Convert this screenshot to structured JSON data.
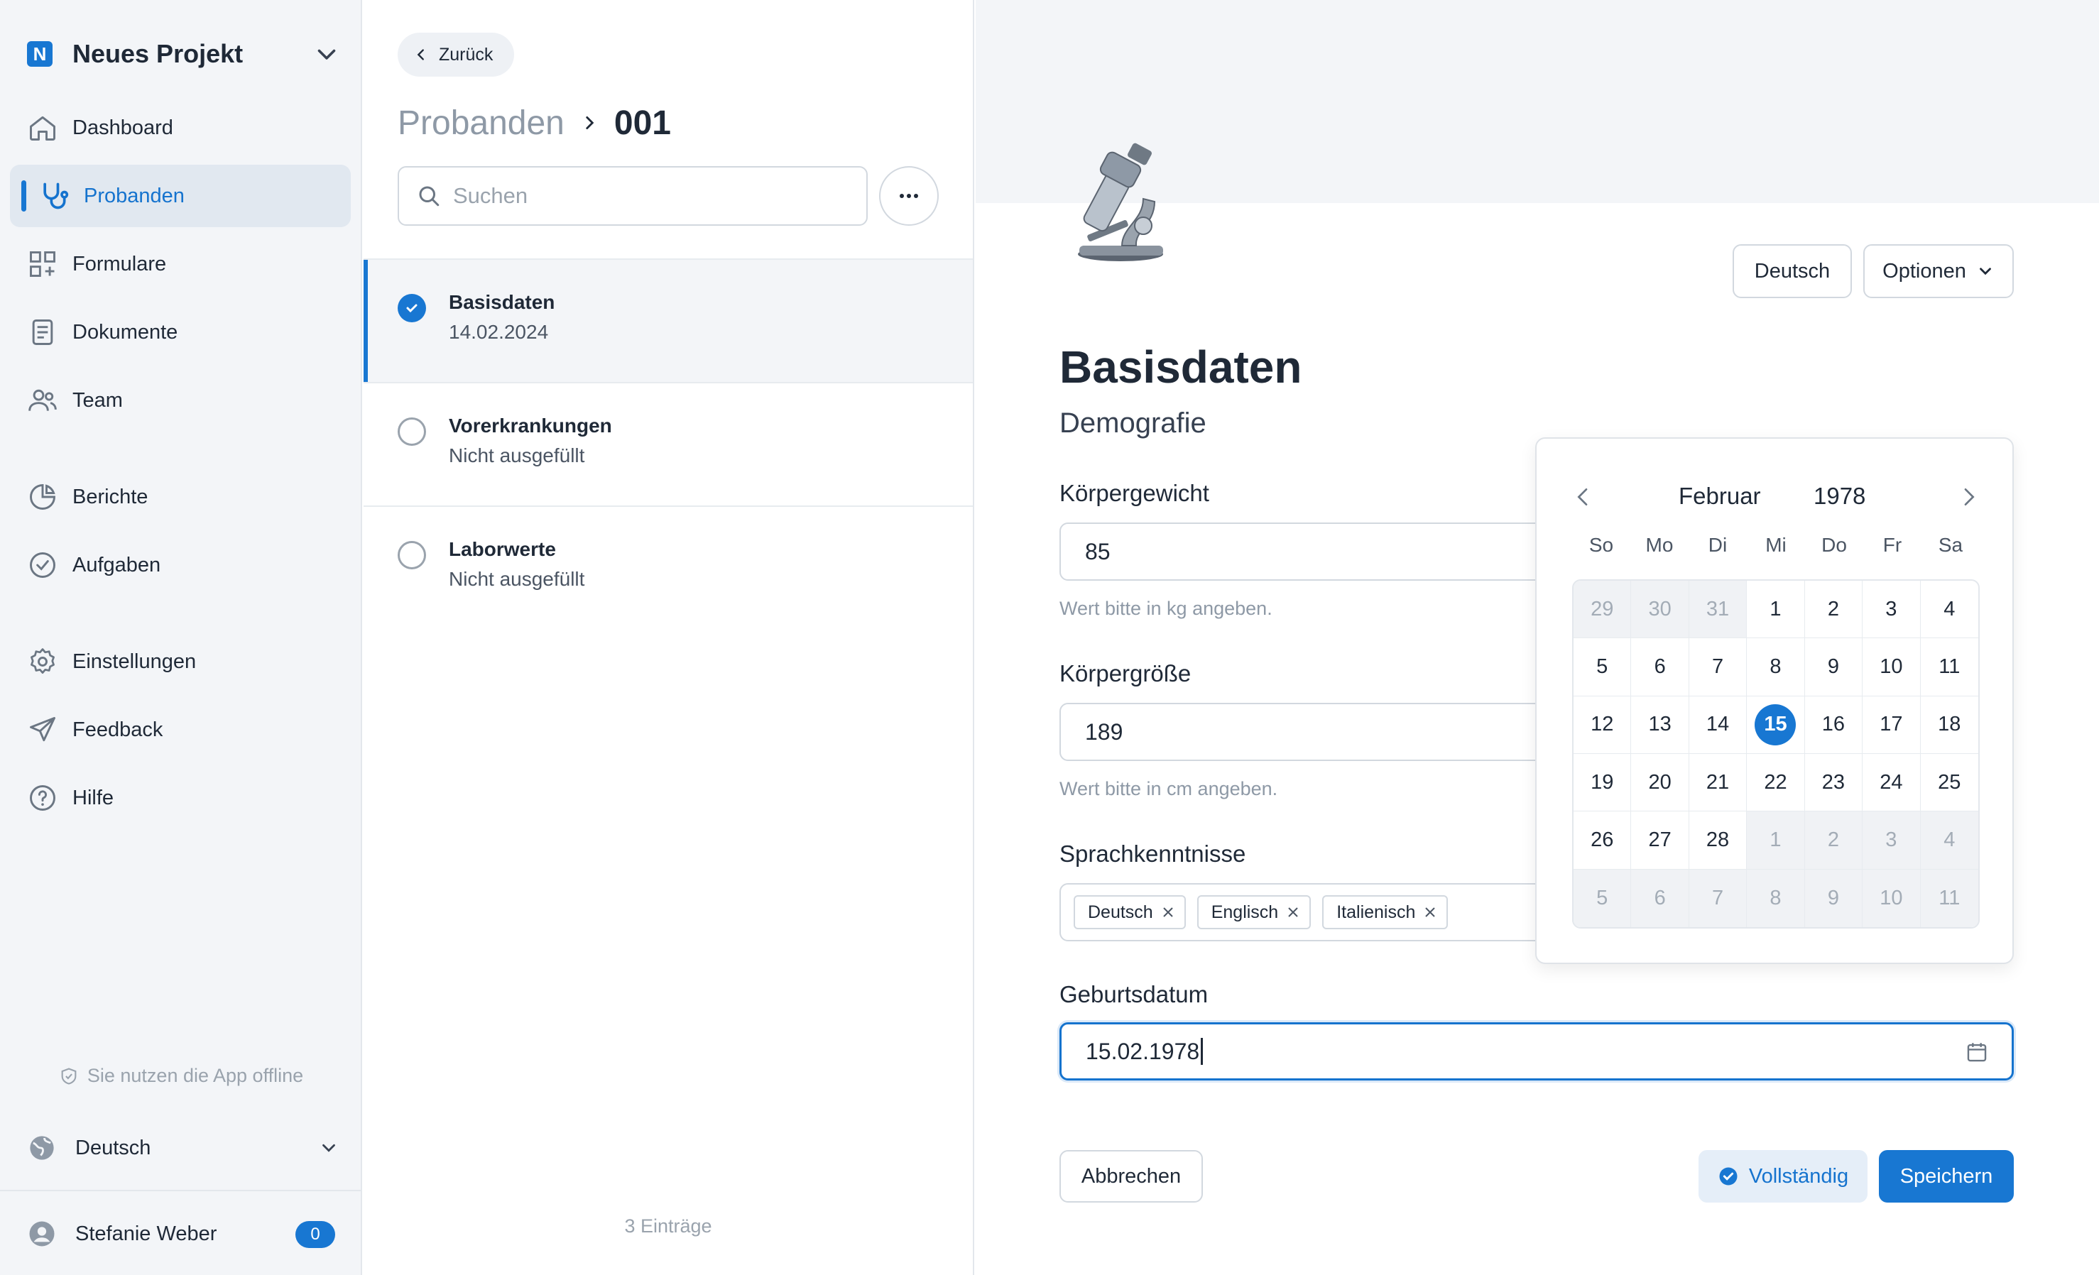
{
  "sidebar": {
    "project_logo": "N",
    "project_name": "Neues Projekt",
    "items": [
      {
        "label": "Dashboard",
        "icon": "home-icon"
      },
      {
        "label": "Probanden",
        "icon": "stethoscope-icon",
        "active": true
      },
      {
        "label": "Formulare",
        "icon": "grid-plus-icon"
      },
      {
        "label": "Dokumente",
        "icon": "document-icon"
      },
      {
        "label": "Team",
        "icon": "users-icon"
      },
      {
        "label": "Berichte",
        "icon": "pie-chart-icon"
      },
      {
        "label": "Aufgaben",
        "icon": "check-circle-icon"
      },
      {
        "label": "Einstellungen",
        "icon": "gear-icon"
      },
      {
        "label": "Feedback",
        "icon": "send-icon"
      },
      {
        "label": "Hilfe",
        "icon": "help-icon"
      }
    ],
    "offline_text": "Sie nutzen die App offline",
    "language": "Deutsch",
    "user_name": "Stefanie Weber",
    "user_badge": "0"
  },
  "list": {
    "back_label": "Zurück",
    "breadcrumb_parent": "Probanden",
    "breadcrumb_current": "001",
    "search_placeholder": "Suchen",
    "items": [
      {
        "title": "Basisdaten",
        "subtitle": "14.02.2024",
        "checked": true
      },
      {
        "title": "Vorerkrankungen",
        "subtitle": "Nicht ausgefüllt",
        "checked": false
      },
      {
        "title": "Laborwerte",
        "subtitle": "Nicht ausgefüllt",
        "checked": false
      }
    ],
    "count_text": "3 Einträge"
  },
  "form": {
    "language_button": "Deutsch",
    "options_button": "Optionen",
    "title": "Basisdaten",
    "subtitle": "Demografie",
    "weight_label": "Körpergewicht",
    "weight_value": "85",
    "weight_help": "Wert bitte in kg angeben.",
    "height_label": "Körpergröße",
    "height_value": "189",
    "height_help": "Wert bitte in cm angeben.",
    "languages_label": "Sprachkenntnisse",
    "languages": [
      "Deutsch",
      "Englisch",
      "Italienisch"
    ],
    "birthdate_label": "Geburtsdatum",
    "birthdate_value": "15.02.1978",
    "cancel_label": "Abbrechen",
    "complete_label": "Vollständig",
    "save_label": "Speichern"
  },
  "calendar": {
    "month": "Februar",
    "year": "1978",
    "weekdays": [
      "So",
      "Mo",
      "Di",
      "Mi",
      "Do",
      "Fr",
      "Sa"
    ],
    "days": [
      {
        "d": "29",
        "out": true
      },
      {
        "d": "30",
        "out": true
      },
      {
        "d": "31",
        "out": true
      },
      {
        "d": "1"
      },
      {
        "d": "2"
      },
      {
        "d": "3"
      },
      {
        "d": "4"
      },
      {
        "d": "5"
      },
      {
        "d": "6"
      },
      {
        "d": "7"
      },
      {
        "d": "8"
      },
      {
        "d": "9"
      },
      {
        "d": "10"
      },
      {
        "d": "11"
      },
      {
        "d": "12"
      },
      {
        "d": "13"
      },
      {
        "d": "14"
      },
      {
        "d": "15",
        "selected": true
      },
      {
        "d": "16"
      },
      {
        "d": "17"
      },
      {
        "d": "18"
      },
      {
        "d": "19"
      },
      {
        "d": "20"
      },
      {
        "d": "21"
      },
      {
        "d": "22"
      },
      {
        "d": "23"
      },
      {
        "d": "24"
      },
      {
        "d": "25"
      },
      {
        "d": "26"
      },
      {
        "d": "27"
      },
      {
        "d": "28"
      },
      {
        "d": "1",
        "out": true
      },
      {
        "d": "2",
        "out": true
      },
      {
        "d": "3",
        "out": true
      },
      {
        "d": "4",
        "out": true
      },
      {
        "d": "5",
        "out": true
      },
      {
        "d": "6",
        "out": true
      },
      {
        "d": "7",
        "out": true
      },
      {
        "d": "8",
        "out": true
      },
      {
        "d": "9",
        "out": true
      },
      {
        "d": "10",
        "out": true
      },
      {
        "d": "11",
        "out": true
      }
    ]
  },
  "colors": {
    "accent": "#1877d2",
    "sidebar_bg": "#f3f5f8",
    "muted_text": "#8e99a6"
  }
}
